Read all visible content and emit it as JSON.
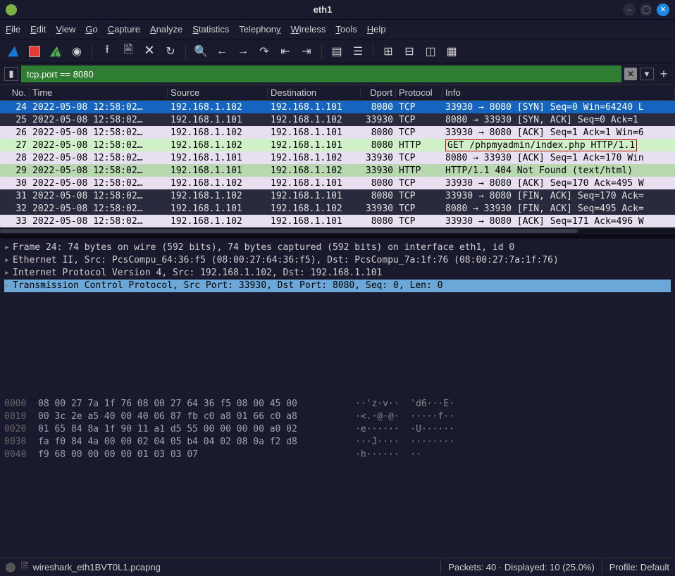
{
  "window": {
    "title": "eth1"
  },
  "menus": [
    "File",
    "Edit",
    "View",
    "Go",
    "Capture",
    "Analyze",
    "Statistics",
    "Telephony",
    "Wireless",
    "Tools",
    "Help"
  ],
  "filter": {
    "value": "tcp.port == 8080"
  },
  "columns": {
    "no": "No.",
    "time": "Time",
    "src": "Source",
    "dst": "Destination",
    "dport": "Dport",
    "proto": "Protocol",
    "info": "Info"
  },
  "packets": [
    {
      "no": "24",
      "time": "2022-05-08 12:58:02…",
      "src": "192.168.1.102",
      "dst": "192.168.1.101",
      "dport": "8080",
      "proto": "TCP",
      "info": "33930 → 8080  [SYN]  Seq=0 Win=64240 L",
      "style": "row-sel"
    },
    {
      "no": "25",
      "time": "2022-05-08 12:58:02…",
      "src": "192.168.1.101",
      "dst": "192.168.1.102",
      "dport": "33930",
      "proto": "TCP",
      "info": "8080 → 33930 [SYN, ACK] Seq=0 Ack=1",
      "style": "row-lightsynack"
    },
    {
      "no": "26",
      "time": "2022-05-08 12:58:02…",
      "src": "192.168.1.102",
      "dst": "192.168.1.101",
      "dport": "8080",
      "proto": "TCP",
      "info": "33930 → 8080 [ACK]  Seq=1 Ack=1 Win=6",
      "style": "row-lilac"
    },
    {
      "no": "27",
      "time": "2022-05-08 12:58:02…",
      "src": "192.168.1.102",
      "dst": "192.168.1.101",
      "dport": "8080",
      "proto": "HTTP",
      "info": "GET /phpmyadmin/index.php HTTP/1.1",
      "style": "row-green",
      "boxed": true
    },
    {
      "no": "28",
      "time": "2022-05-08 12:58:02…",
      "src": "192.168.1.101",
      "dst": "192.168.1.102",
      "dport": "33930",
      "proto": "TCP",
      "info": "8080 → 33930 [ACK] Seq=1 Ack=170 Win",
      "style": "row-lilac"
    },
    {
      "no": "29",
      "time": "2022-05-08 12:58:02…",
      "src": "192.168.1.101",
      "dst": "192.168.1.102",
      "dport": "33930",
      "proto": "HTTP",
      "info": "HTTP/1.1 404 Not Found  (text/html)",
      "style": "row-greensel"
    },
    {
      "no": "30",
      "time": "2022-05-08 12:58:02…",
      "src": "192.168.1.102",
      "dst": "192.168.1.101",
      "dport": "8080",
      "proto": "TCP",
      "info": "33930 → 8080 [ACK] Seq=170 Ack=495 W",
      "style": "row-lilac"
    },
    {
      "no": "31",
      "time": "2022-05-08 12:58:02…",
      "src": "192.168.1.102",
      "dst": "192.168.1.101",
      "dport": "8080",
      "proto": "TCP",
      "info": "33930 → 8080 [FIN, ACK] Seq=170 Ack=",
      "style": "row-lightsynack"
    },
    {
      "no": "32",
      "time": "2022-05-08 12:58:02…",
      "src": "192.168.1.101",
      "dst": "192.168.1.102",
      "dport": "33930",
      "proto": "TCP",
      "info": "8080 → 33930 [FIN, ACK] Seq=495 Ack=",
      "style": "row-lightsynack"
    },
    {
      "no": "33",
      "time": "2022-05-08 12:58:02…",
      "src": "192.168.1.102",
      "dst": "192.168.1.101",
      "dport": "8080",
      "proto": "TCP",
      "info": "33930 → 8080 [ACK] Seq=171 Ack=496 W",
      "style": "row-lilac"
    }
  ],
  "details": [
    "Frame 24: 74 bytes on wire (592 bits), 74 bytes captured (592 bits) on interface eth1, id 0",
    "Ethernet II, Src: PcsCompu_64:36:f5 (08:00:27:64:36:f5), Dst: PcsCompu_7a:1f:76 (08:00:27:7a:1f:76)",
    "Internet Protocol Version 4, Src: 192.168.1.102, Dst: 192.168.1.101",
    "Transmission Control Protocol, Src Port: 33930, Dst Port: 8080, Seq: 0, Len: 0"
  ],
  "hex": [
    {
      "off": "0000",
      "b": "08 00 27 7a 1f 76 08 00  27 64 36 f5 08 00 45 00",
      "a": "··'z·v··  'd6···E·"
    },
    {
      "off": "0010",
      "b": "00 3c 2e a5 40 00 40 06  87 fb c0 a8 01 66 c0 a8",
      "a": "·<.·@·@·  ·····f··"
    },
    {
      "off": "0020",
      "b": "01 65 84 8a 1f 90 11 a1  d5 55 00 00 00 00 a0 02",
      "a": "·e······  ·U······"
    },
    {
      "off": "0030",
      "b": "fa f0 84 4a 00 00 02 04  05 b4 04 02 08 0a f2 d8",
      "a": "···J····  ········"
    },
    {
      "off": "0040",
      "b": "f9 68 00 00 00 00 01 03  03 07",
      "a": "·h······  ··"
    }
  ],
  "status": {
    "file": "wireshark_eth1BVT0L1.pcapng",
    "packets": "Packets: 40 · Displayed: 10 (25.0%)",
    "profile": "Profile: Default"
  }
}
